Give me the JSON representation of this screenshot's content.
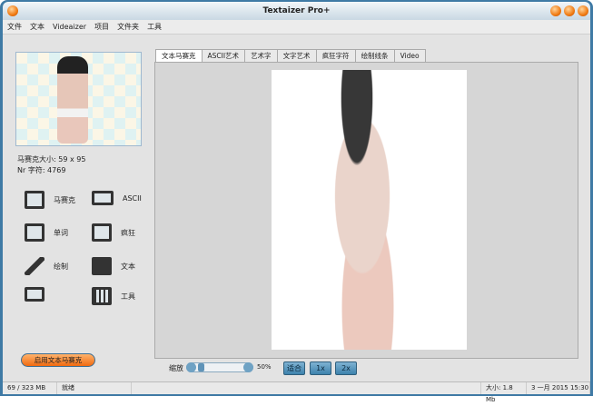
{
  "window": {
    "title": "Textaizer Pro+"
  },
  "menu": [
    "文件",
    "文本",
    "Videaizer",
    "项目",
    "文件夹",
    "工具"
  ],
  "info": {
    "mosaic_size": "马赛克大小: 59 x 95",
    "chars": "Nr 字符: 4769"
  },
  "tools": [
    {
      "label": "马赛克",
      "icon": "mosaic-icon"
    },
    {
      "label": "ASCII",
      "icon": "keyboard-icon"
    },
    {
      "label": "单词",
      "icon": "book-icon"
    },
    {
      "label": "疯狂",
      "icon": "waveform-icon"
    },
    {
      "label": "绘制",
      "icon": "feather-icon"
    },
    {
      "label": "文本",
      "icon": "pen-icon"
    },
    {
      "label": "",
      "icon": "clapper-icon"
    },
    {
      "label": "工具",
      "icon": "sliders-icon"
    }
  ],
  "tabs": [
    "文本马赛克",
    "ASCII艺术",
    "艺术字",
    "文字艺术",
    "疯狂字符",
    "绘制线条",
    "Video"
  ],
  "start_button": "启用文本马赛克",
  "zoom": {
    "label": "缩放",
    "value": "50%",
    "percent": 50,
    "fit": "适合",
    "x1": "1x",
    "x2": "2x"
  },
  "status": {
    "memory": "69 / 323 MB",
    "state": "就绪",
    "size": "大小: 1.8 Mb",
    "date": "3 一月 2015  15:30"
  }
}
